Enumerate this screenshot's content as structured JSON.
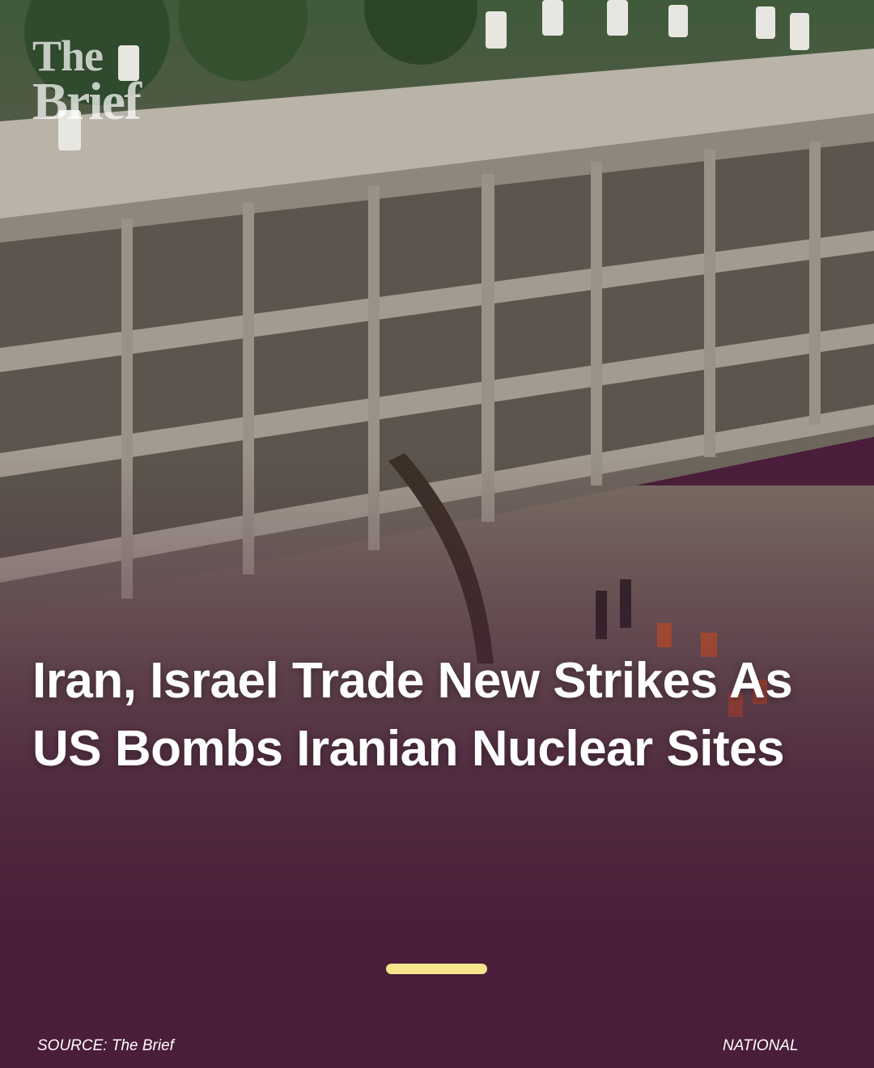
{
  "brand": {
    "line1": "The",
    "line2": "Brief"
  },
  "headline": "Iran, Israel Trade New Strikes As US Bombs Iranian Nuclear Sites",
  "footer": {
    "source": "SOURCE: The Brief",
    "category": "NATIONAL"
  },
  "colors": {
    "overlay": "#4a1d3a",
    "accent": "#f6e58c",
    "text": "#ffffff"
  },
  "image": {
    "subject": "damaged-building-photo"
  }
}
